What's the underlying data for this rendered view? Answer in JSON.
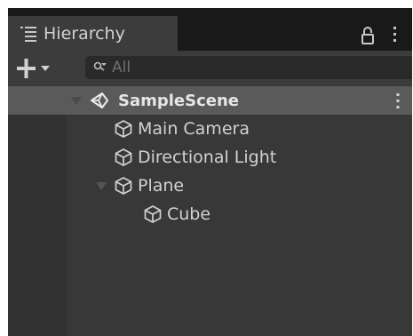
{
  "panel": {
    "tab_title": "Hierarchy",
    "tab_icon": "hierarchy-list-icon",
    "lock_icon": "lock-icon",
    "menu_icon": "more-vertical-icon"
  },
  "toolbar": {
    "add_icon": "plus-dropdown-icon",
    "search_placeholder": "All",
    "search_value": ""
  },
  "tree": {
    "scene": {
      "name": "SampleScene",
      "icon": "unity-scene-icon",
      "expanded": true
    },
    "items": [
      {
        "name": "Main Camera",
        "icon": "cube-icon",
        "depth": 1
      },
      {
        "name": "Directional Light",
        "icon": "cube-icon",
        "depth": 1
      },
      {
        "name": "Plane",
        "icon": "cube-icon",
        "depth": 1,
        "expanded": true
      },
      {
        "name": "Cube",
        "icon": "cube-icon",
        "depth": 2
      }
    ]
  },
  "colors": {
    "panel_bg": "#383838",
    "tab_bar_bg": "#191919",
    "selected_row_bg": "#5a5a5a",
    "text": "#d2d2d2"
  }
}
